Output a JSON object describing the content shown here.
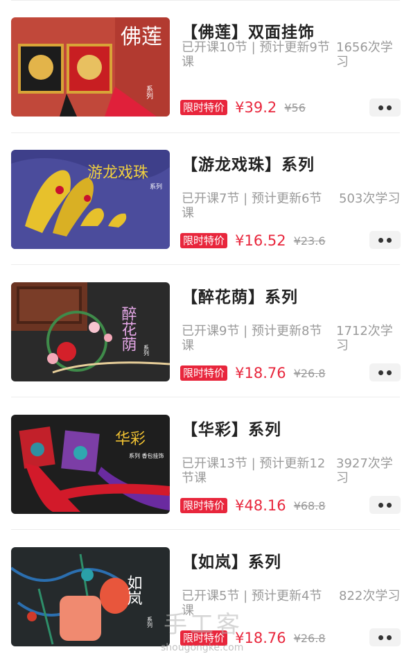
{
  "courses": [
    {
      "title": "【佛莲】双面挂饰",
      "meta": "已开课10节 | 预计更新9节课",
      "count": "1656次学习",
      "badge": "限时特价",
      "price": "¥39.2",
      "original_price": "¥56",
      "thumb_text": "佛莲",
      "thumb_sub": "系列"
    },
    {
      "title": "【游龙戏珠】系列",
      "meta": "已开课7节 | 预计更新6节课",
      "count": "503次学习",
      "badge": "限时特价",
      "price": "¥16.52",
      "original_price": "¥23.6",
      "thumb_text": "游龙戏珠",
      "thumb_sub": "系列"
    },
    {
      "title": "【醉花荫】系列",
      "meta": "已开课9节 | 预计更新8节课",
      "count": "1712次学习",
      "badge": "限时特价",
      "price": "¥18.76",
      "original_price": "¥26.8",
      "thumb_text": "醉花荫",
      "thumb_sub": "系列"
    },
    {
      "title": "【华彩】系列",
      "meta": "已开课13节 | 预计更新12节课",
      "count": "3927次学习",
      "badge": "限时特价",
      "price": "¥48.16",
      "original_price": "¥68.8",
      "thumb_text": "华彩",
      "thumb_sub": "系列 香包挂饰"
    },
    {
      "title": "【如岚】系列",
      "meta": "已开课5节 | 预计更新4节课",
      "count": "822次学习",
      "badge": "限时特价",
      "price": "¥18.76",
      "original_price": "¥26.8",
      "thumb_text": "如岚",
      "thumb_sub": "系列"
    }
  ],
  "watermark": {
    "cn": "手工客",
    "en": "shougongke.com"
  },
  "colors": {
    "accent": "#e8263c",
    "muted": "#9a9a9a",
    "title": "#222222"
  }
}
